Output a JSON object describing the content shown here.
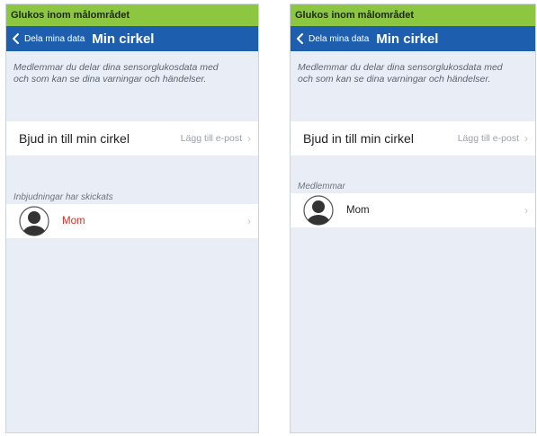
{
  "screens": [
    {
      "status_title": "Glukos inom målområdet",
      "back_label": "Dela mina data",
      "nav_title": "Min cirkel",
      "description_lines": [
        "Medlemmar du delar dina sensorglukosdata med",
        "och som kan se dina varningar och händelser."
      ],
      "invite_title": "Bjud in till min cirkel",
      "invite_detail": "Lägg till e-post",
      "section_label": "Inbjudningar har skickats",
      "member_name": "Mom"
    },
    {
      "status_title": "Glukos inom målområdet",
      "back_label": "Dela mina data",
      "nav_title": "Min cirkel",
      "description_lines": [
        "Medlemmar du delar dina sensorglukosdata med",
        "och som kan se dina varningar och händelser."
      ],
      "invite_title": "Bjud in till min cirkel",
      "invite_detail": "Lägg till e-post",
      "section_label": "Medlemmar",
      "member_name": "Mom"
    }
  ],
  "icons": {
    "back": "chevron-left-icon",
    "row_chevron": "chevron-right-icon",
    "avatar": "person-avatar-icon"
  },
  "colors": {
    "status_bar": "#8dc641",
    "nav_bar": "#1d5fae",
    "background": "#e9eef6",
    "pending_member": "#e0251b"
  }
}
